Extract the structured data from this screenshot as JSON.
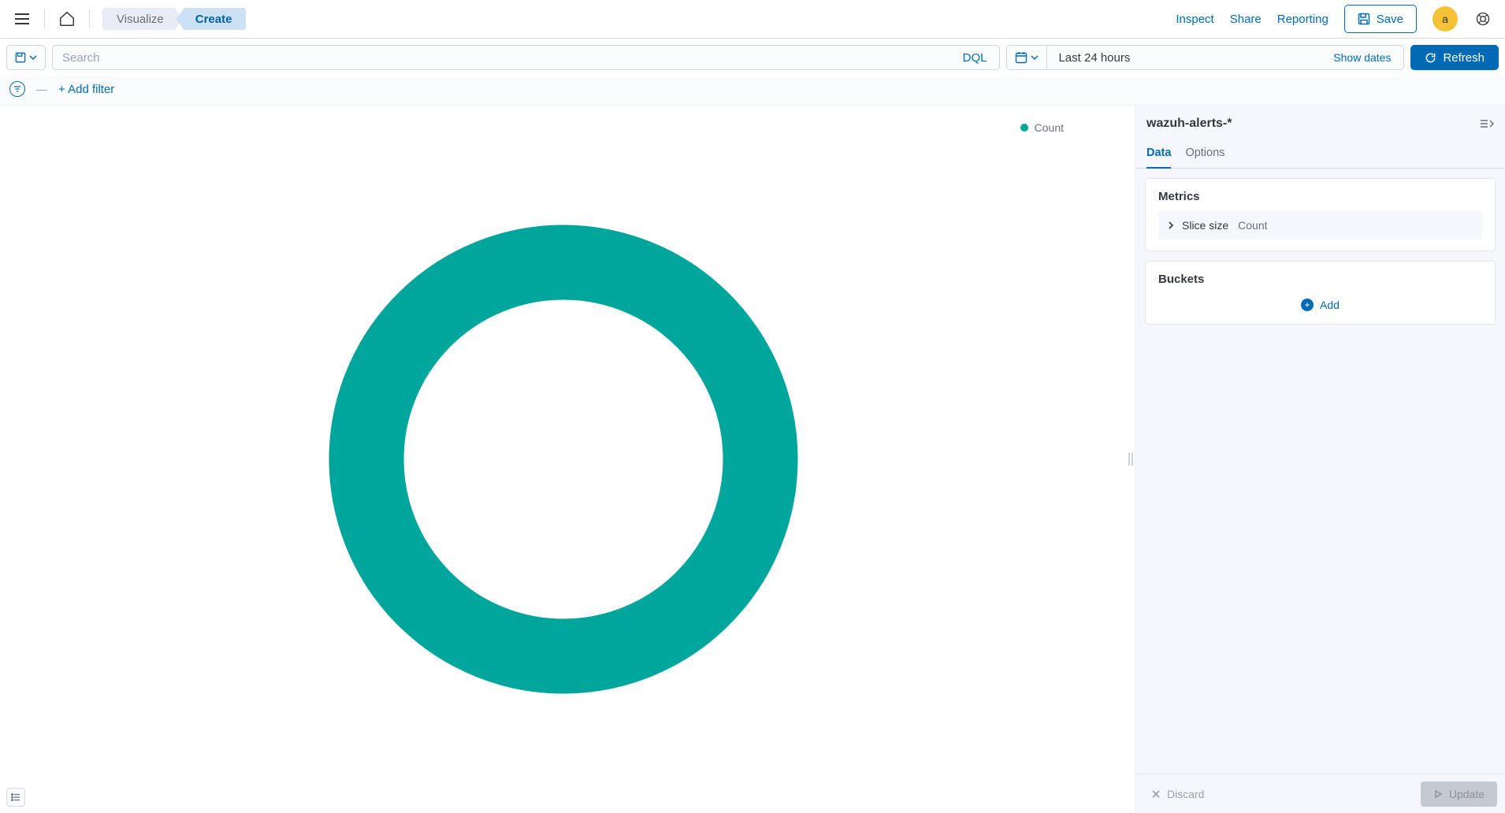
{
  "header": {
    "breadcrumbs": {
      "visualize": "Visualize",
      "create": "Create"
    },
    "links": {
      "inspect": "Inspect",
      "share": "Share",
      "reporting": "Reporting"
    },
    "save_label": "Save",
    "avatar_letter": "a"
  },
  "query": {
    "search_placeholder": "Search",
    "dql_label": "DQL",
    "time_label": "Last 24 hours",
    "show_dates_label": "Show dates",
    "refresh_label": "Refresh"
  },
  "filter": {
    "add_filter_label": "+ Add filter"
  },
  "legend": {
    "series": "Count"
  },
  "editor": {
    "index_pattern": "wazuh-alerts-*",
    "tabs": {
      "data": "Data",
      "options": "Options"
    },
    "metrics_title": "Metrics",
    "metric_label": "Slice size",
    "metric_value": "Count",
    "buckets_title": "Buckets",
    "add_label": "Add",
    "discard_label": "Discard",
    "update_label": "Update"
  },
  "colors": {
    "accent": "#006bb4",
    "series": "#00a69b"
  },
  "chart_data": {
    "type": "pie",
    "title": "",
    "series": [
      {
        "name": "Count",
        "value": 1,
        "color": "#00a69b"
      }
    ],
    "donut": true,
    "legend_position": "right"
  }
}
